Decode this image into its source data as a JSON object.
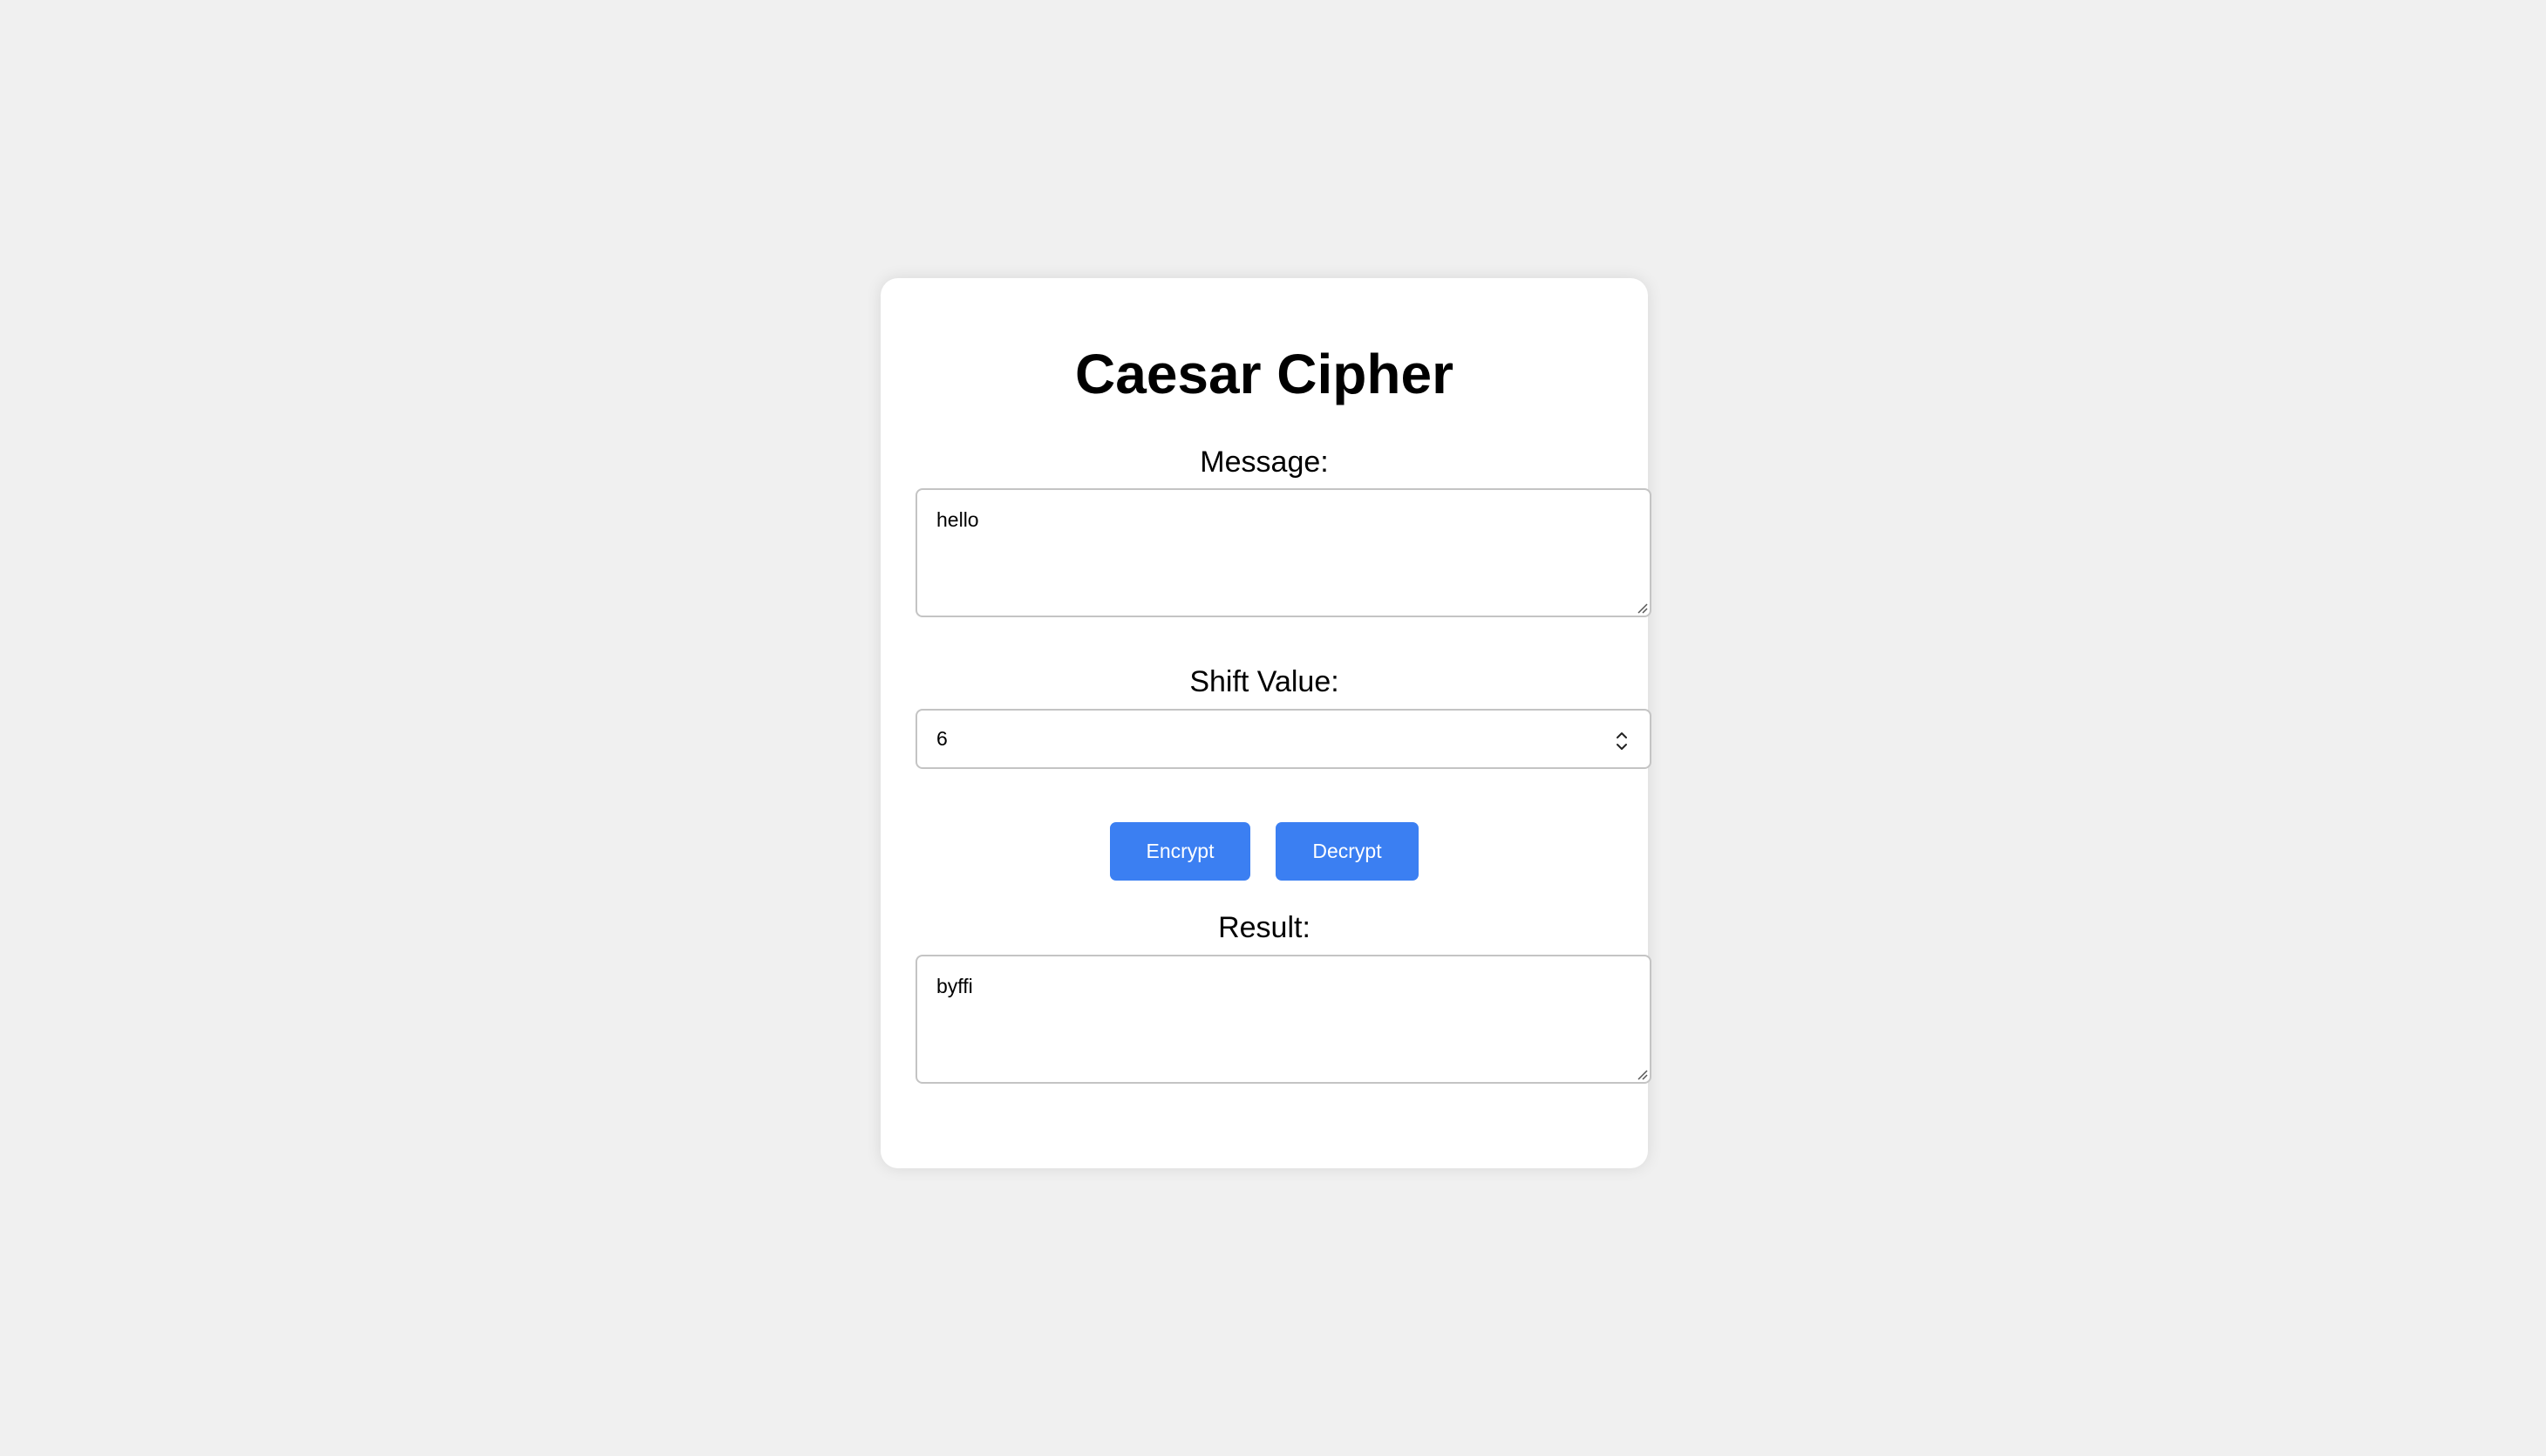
{
  "app": {
    "title": "Caesar Cipher"
  },
  "message": {
    "label": "Message:",
    "value": "hello"
  },
  "shift": {
    "label": "Shift Value:",
    "value": "6"
  },
  "actions": {
    "encrypt_label": "Encrypt",
    "decrypt_label": "Decrypt"
  },
  "result": {
    "label": "Result:",
    "value": "byffi"
  },
  "colors": {
    "page_background": "#f0f0f0",
    "card_background": "#ffffff",
    "accent": "#3b7ff2",
    "field_border": "#c4c4c4"
  },
  "icons": {
    "spinner": "stepper-arrows-icon",
    "resize": "resize-grip-icon"
  }
}
